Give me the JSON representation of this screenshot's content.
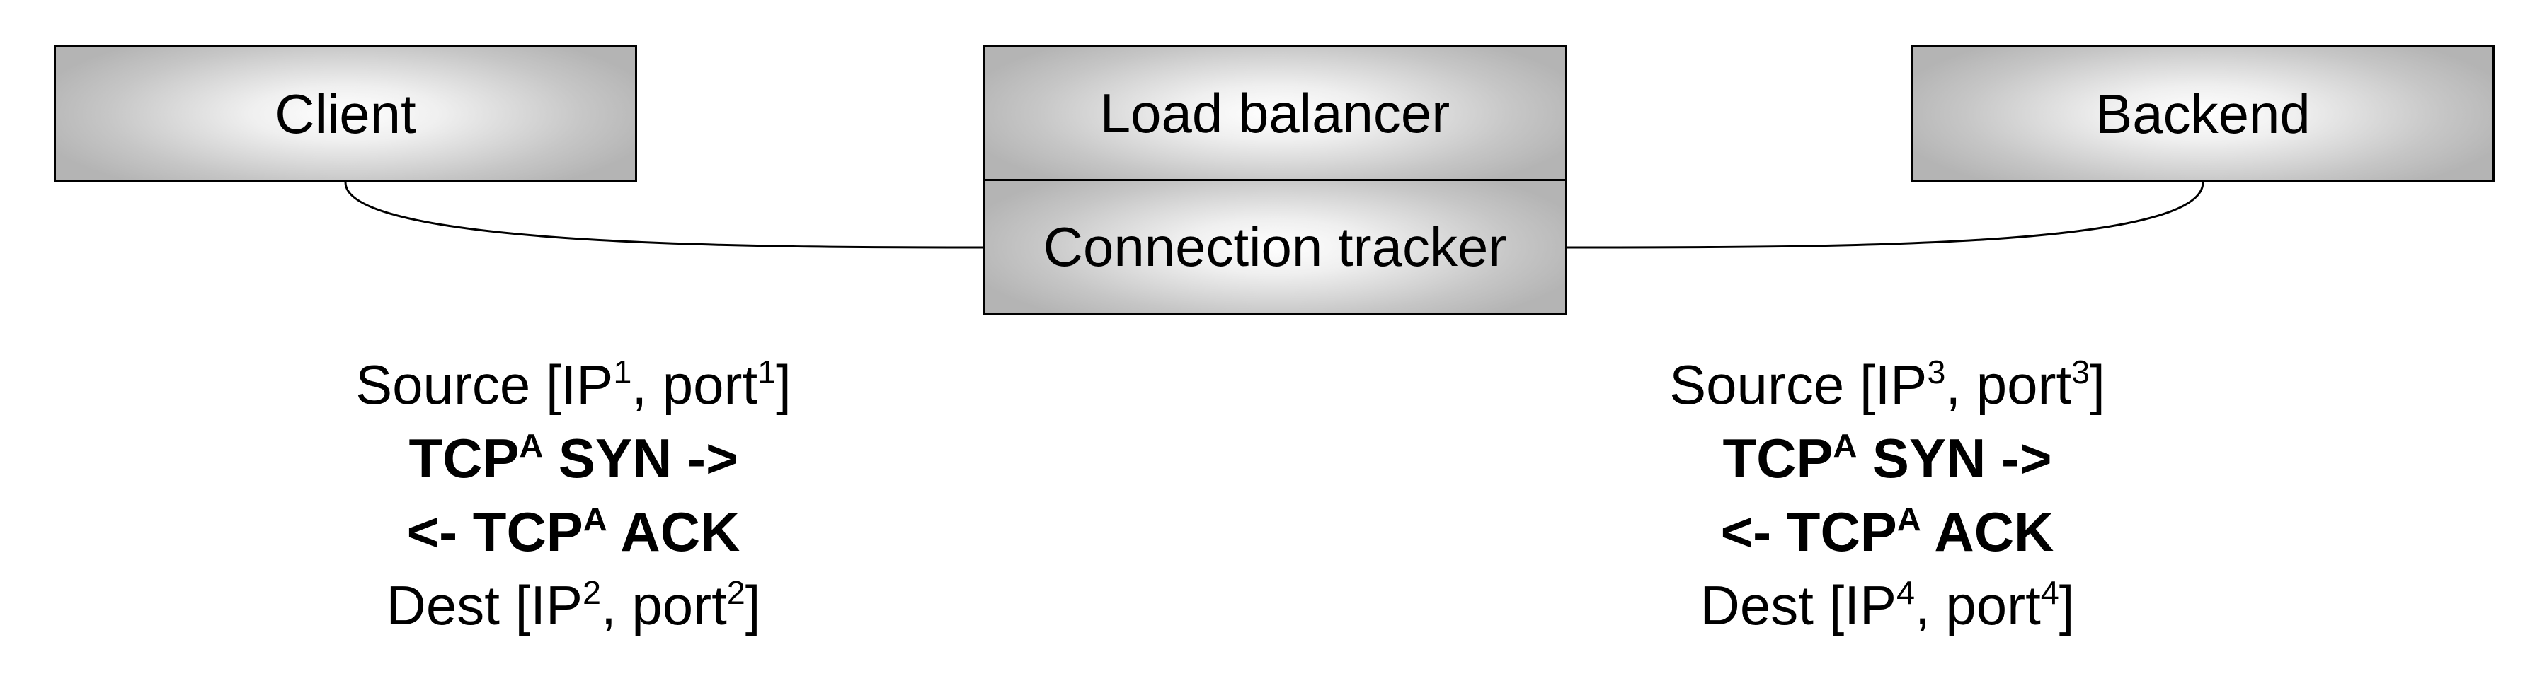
{
  "boxes": {
    "client": "Client",
    "load_balancer": "Load balancer",
    "connection_tracker": "Connection tracker",
    "backend": "Backend"
  },
  "left_connection": {
    "source_prefix": "Source [IP",
    "source_ip_sup": "1",
    "source_mid": ", port",
    "source_port_sup": "1",
    "source_suffix": "]",
    "syn_prefix": "TCP",
    "syn_sup": "A",
    "syn_suffix": " SYN ->",
    "ack_prefix": "<- TCP",
    "ack_sup": "A",
    "ack_suffix": " ACK",
    "dest_prefix": "Dest [IP",
    "dest_ip_sup": "2",
    "dest_mid": ", port",
    "dest_port_sup": "2",
    "dest_suffix": "]"
  },
  "right_connection": {
    "source_prefix": "Source [IP",
    "source_ip_sup": "3",
    "source_mid": ", port",
    "source_port_sup": "3",
    "source_suffix": "]",
    "syn_prefix": "TCP",
    "syn_sup": "A",
    "syn_suffix": " SYN ->",
    "ack_prefix": "<- TCP",
    "ack_sup": "A",
    "ack_suffix": " ACK",
    "dest_prefix": "Dest [IP",
    "dest_ip_sup": "4",
    "dest_mid": ", port",
    "dest_port_sup": "4",
    "dest_suffix": "]"
  }
}
